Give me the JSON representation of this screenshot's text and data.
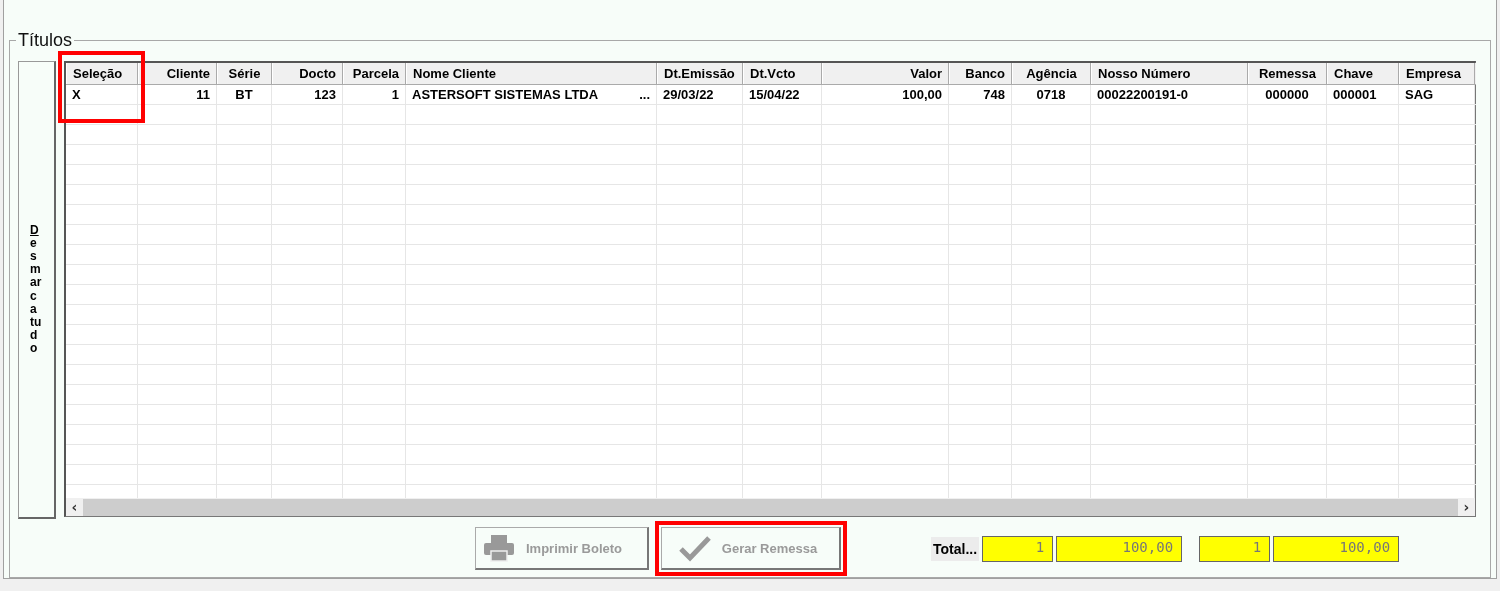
{
  "group": {
    "title": "Títulos"
  },
  "side_button": {
    "label": "Desmarca tudo"
  },
  "table": {
    "columns": [
      {
        "label": "Seleção",
        "highlighted": true
      },
      {
        "label": "Cliente",
        "highlighted": false
      },
      {
        "label": "Série",
        "highlighted": false
      },
      {
        "label": "Docto",
        "highlighted": false
      },
      {
        "label": "Parcela",
        "highlighted": false
      },
      {
        "label": "Nome Cliente",
        "highlighted": false
      },
      {
        "label": "Dt.Emissão",
        "highlighted": false
      },
      {
        "label": "Dt.Vcto",
        "highlighted": false
      },
      {
        "label": "Valor",
        "highlighted": false
      },
      {
        "label": "Banco",
        "highlighted": false
      },
      {
        "label": "Agência",
        "highlighted": false
      },
      {
        "label": "Nosso Número",
        "highlighted": false
      },
      {
        "label": "Remessa",
        "highlighted": false
      },
      {
        "label": "Chave",
        "highlighted": false
      },
      {
        "label": "Empresa",
        "highlighted": false
      }
    ],
    "rows": [
      {
        "cells": [
          "X",
          "11",
          "BT",
          "123",
          "1",
          "ASTERSOFT SISTEMAS LTDA",
          "29/03/22",
          "15/04/22",
          "100,00",
          "748",
          "0718",
          "00022200191-0",
          "000000",
          "000001",
          "SAG"
        ],
        "lookup_marker": "..."
      }
    ],
    "scroll_left": "‹",
    "scroll_right": "›"
  },
  "buttons": [
    {
      "kind": "print",
      "label": "Imprimir Boleto",
      "disabled": true,
      "highlighted": false
    },
    {
      "kind": "check",
      "label": "Gerar Remessa",
      "disabled": true,
      "highlighted": true
    }
  ],
  "totals": {
    "label": "Total...",
    "fields": [
      "1",
      "100,00",
      "1",
      "100,00"
    ]
  }
}
